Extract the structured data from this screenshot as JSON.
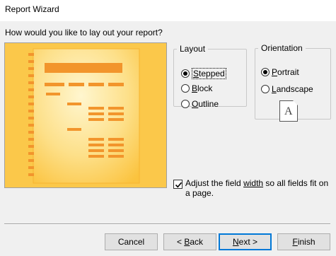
{
  "window": {
    "title": "Report Wizard"
  },
  "prompt": "How would you like to lay out your report?",
  "layout": {
    "legend": "Layout",
    "options": [
      {
        "label": "Stepped",
        "selected": true
      },
      {
        "label": "Block",
        "selected": false
      },
      {
        "label": "Outline",
        "selected": false
      }
    ]
  },
  "orientation": {
    "legend": "Orientation",
    "options": [
      {
        "label": "Portrait",
        "selected": true
      },
      {
        "label": "Landscape",
        "selected": false
      }
    ],
    "icon_letter": "A"
  },
  "adjust_field_width": {
    "checked": true,
    "label_part1": "Adjust the field ",
    "label_part2": "width",
    "label_part3": " so all fields fit on a page."
  },
  "buttons": {
    "cancel": "Cancel",
    "back_prefix": "< ",
    "back_text": "Back",
    "next_text": "Next",
    "next_suffix": " >",
    "finish": "Finish"
  },
  "colors": {
    "preview_background": "#fbc84a",
    "preview_accent": "#f2952c",
    "default_button_border": "#0078d7"
  }
}
